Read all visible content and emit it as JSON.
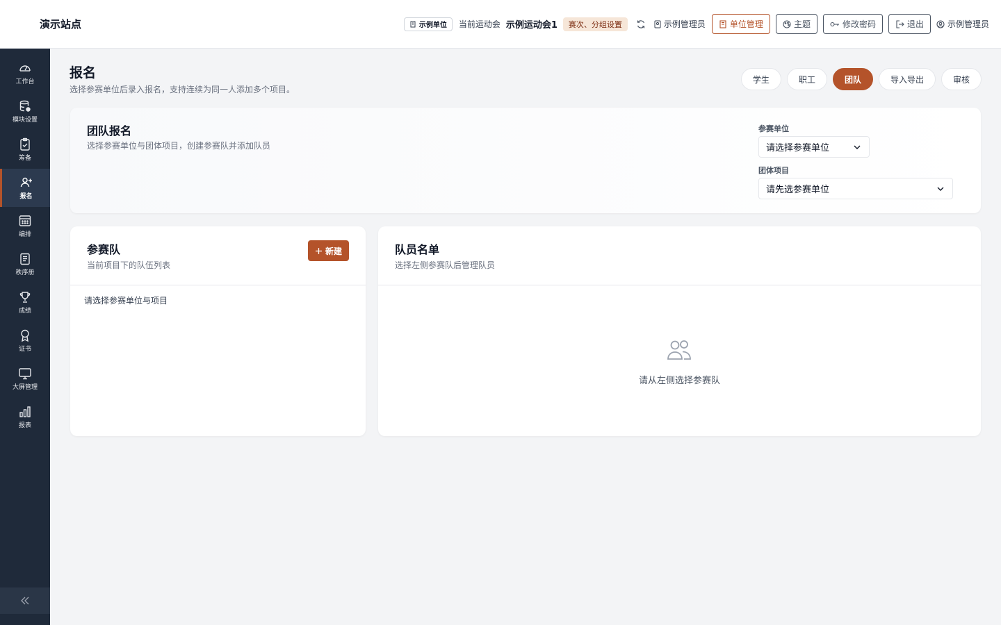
{
  "header": {
    "site_title": "演示站点",
    "unit_chip": "示例单位",
    "current_label": "当前运动会",
    "current_name": "示例运动会1",
    "round_chip": "赛次、分组设置",
    "admin_small": "示例管理员",
    "btn_unit": "单位管理",
    "btn_theme": "主题",
    "btn_password": "修改密码",
    "btn_logout": "退出",
    "user": "示例管理员"
  },
  "sidebar": {
    "items": [
      {
        "label": "工作台",
        "icon": "dashboard-icon"
      },
      {
        "label": "模块设置",
        "icon": "database-icon"
      },
      {
        "label": "筹备",
        "icon": "clipboard-icon"
      },
      {
        "label": "报名",
        "icon": "user-plus-icon"
      },
      {
        "label": "编排",
        "icon": "calendar-icon"
      },
      {
        "label": "秩序册",
        "icon": "book-icon"
      },
      {
        "label": "成绩",
        "icon": "trophy-icon"
      },
      {
        "label": "证书",
        "icon": "award-icon"
      },
      {
        "label": "大屏管理",
        "icon": "monitor-icon"
      },
      {
        "label": "报表",
        "icon": "bar-chart-icon"
      }
    ],
    "active_index": 3
  },
  "page": {
    "title": "报名",
    "subtitle": "选择参赛单位后录入报名，支持连续为同一人添加多个项目。",
    "tabs": [
      "学生",
      "职工",
      "团队",
      "导入导出",
      "审核"
    ],
    "active_tab": 2
  },
  "team_card": {
    "title": "团队报名",
    "subtitle": "选择参赛单位与团体项目，创建参赛队并添加队员",
    "unit_label": "参赛单位",
    "unit_value": "请选择参赛单位",
    "event_label": "团体项目",
    "event_value": "请先选参赛单位"
  },
  "teams_card": {
    "title": "参赛队",
    "subtitle": "当前项目下的队伍列表",
    "new_label": "新建",
    "empty_text": "请选择参赛单位与项目"
  },
  "roster_card": {
    "title": "队员名单",
    "subtitle": "选择左侧参赛队后管理队员",
    "empty_text": "请从左侧选择参赛队"
  },
  "colors": {
    "accent": "#b4532a",
    "sidebar_bg": "#1f2a3a"
  }
}
